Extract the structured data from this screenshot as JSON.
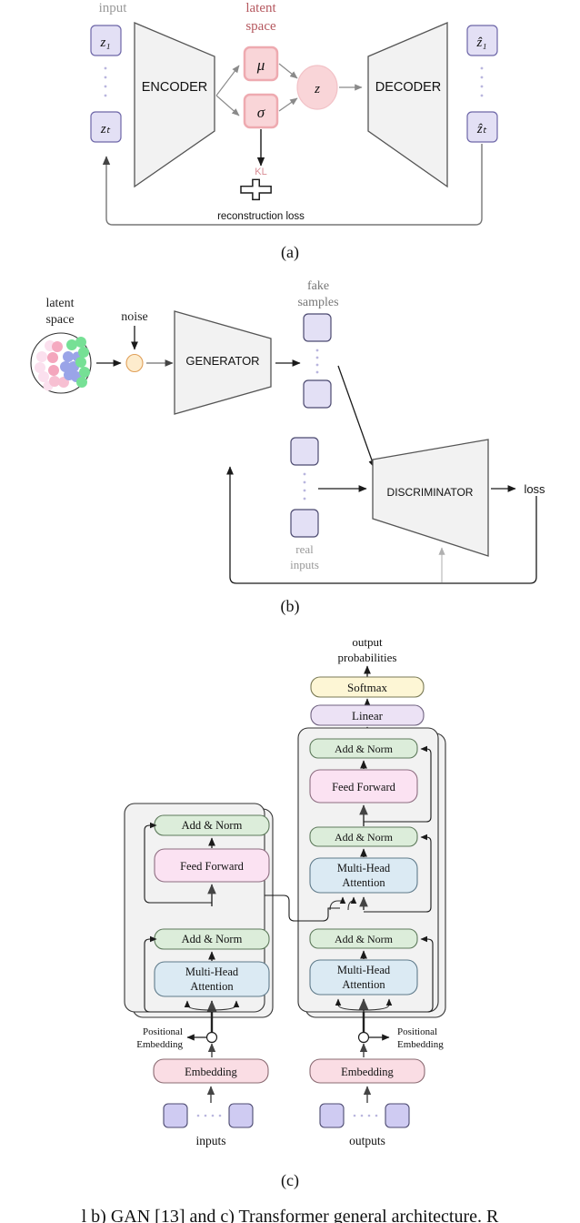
{
  "figure": {
    "panels": [
      {
        "id": "a",
        "caption_label": "(a)",
        "name": "variational-autoencoder",
        "labels": {
          "input": "input",
          "latent_space_line1": "latent",
          "latent_space_line2": "space",
          "encoder": "ENCODER",
          "decoder": "DECODER",
          "mu": "μ",
          "sigma": "σ",
          "z": "z",
          "kl": "KL",
          "plus": "+",
          "reconstruction_loss": "reconstruction loss",
          "input_tokens": [
            "z₁",
            "zₜ"
          ],
          "output_tokens": [
            "ẑ₁",
            "ẑₜ"
          ]
        }
      },
      {
        "id": "b",
        "caption_label": "(b)",
        "name": "generative-adversarial-network",
        "labels": {
          "latent_space_line1": "latent",
          "latent_space_line2": "space",
          "noise": "noise",
          "generator": "GENERATOR",
          "discriminator": "DISCRIMINATOR",
          "fake_samples_line1": "fake",
          "fake_samples_line2": "samples",
          "real_inputs_line1": "real",
          "real_inputs_line2": "inputs",
          "loss": "loss"
        }
      },
      {
        "id": "c",
        "caption_label": "(c)",
        "name": "transformer",
        "labels": {
          "output_probabilities_line1": "output",
          "output_probabilities_line2": "probabilities",
          "softmax": "Softmax",
          "linear": "Linear",
          "add_norm": "Add & Norm",
          "feed_forward": "Feed Forward",
          "multi_head_line1": "Multi-Head",
          "multi_head_line2": "Attention",
          "positional_line1": "Positional",
          "positional_line2": "Embedding",
          "embedding": "Embedding",
          "inputs": "inputs",
          "outputs": "outputs"
        }
      }
    ],
    "caption": "l b) GAN [13] and c) Transformer general architecture. R"
  },
  "colors": {
    "token_fill": "#e3e0f5",
    "token_stroke": "#6d66a8",
    "trapezoid_fill": "#f2f2f2",
    "trapezoid_stroke": "#555555",
    "latent_box_fill": "#f9d5d8",
    "latent_box_stroke": "#e8a0a8",
    "latent_label": "#b5585f",
    "input_label": "#999999",
    "z_circle_fill": "#f9d5d8",
    "noise_fill": "#fdeccd",
    "noise_stroke": "#e0a05a",
    "dot_pink": "#f7c6d9",
    "dot_pink_light": "#fbe0ee",
    "dot_blue": "#9fa8e8",
    "dot_green": "#86e8a0",
    "add_norm_fill": "#dcedda",
    "add_norm_stroke": "#7f9c7d",
    "feed_forward_fill": "#fbe2f2",
    "feed_forward_stroke": "#b98aa8",
    "attention_fill": "#dbeaf3",
    "attention_stroke": "#7f9aab",
    "embedding_fill": "#fadde4",
    "embedding_stroke": "#b98a95",
    "softmax_fill": "#fdf6d5",
    "softmax_stroke": "#b8ae78",
    "linear_fill": "#ece2f5",
    "linear_stroke": "#9d8bb5",
    "block_bg": "#f2f2f2",
    "block_stroke": "#444444",
    "arrow": "#333333",
    "arrow_gray": "#808080",
    "dotted": "#b9b6de",
    "text": "#000000"
  }
}
